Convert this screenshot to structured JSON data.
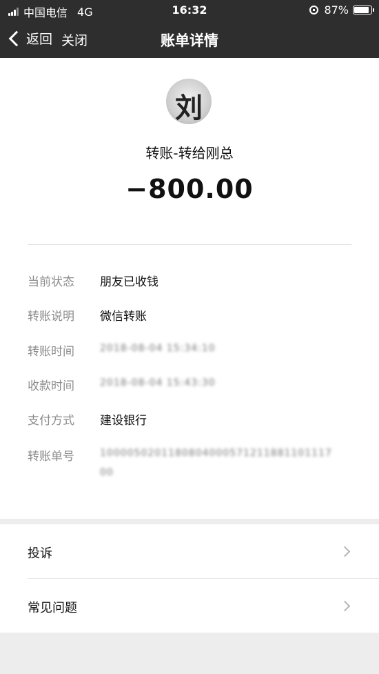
{
  "status_bar": {
    "carrier": "中国电信",
    "network": "4G",
    "time": "16:32",
    "battery": "87%",
    "battery_level": 0.87
  },
  "nav": {
    "back_label": "返回",
    "close_label": "关闭",
    "title": "账单详情"
  },
  "transaction": {
    "avatar_glyph": "刘",
    "payee": "转账-转给刚总",
    "amount": "−800.00"
  },
  "details": [
    {
      "label": "当前状态",
      "value": "朋友已收钱"
    },
    {
      "label": "转账说明",
      "value": "微信转账"
    },
    {
      "label": "转账时间",
      "value": "2018-08-04 15:34:10"
    },
    {
      "label": "收款时间",
      "value": "2018-08-04 15:43:30"
    },
    {
      "label": "支付方式",
      "value": "建设银行"
    },
    {
      "label": "转账单号",
      "value": "1000050201180804000571211881101117",
      "value_line2": "00"
    }
  ],
  "menu": [
    {
      "label": "投诉"
    },
    {
      "label": "常见问题"
    }
  ],
  "colors": {
    "header_bg": "#2e2e2e",
    "page_bg": "#ededed",
    "label_gray": "#8c8c8c"
  }
}
